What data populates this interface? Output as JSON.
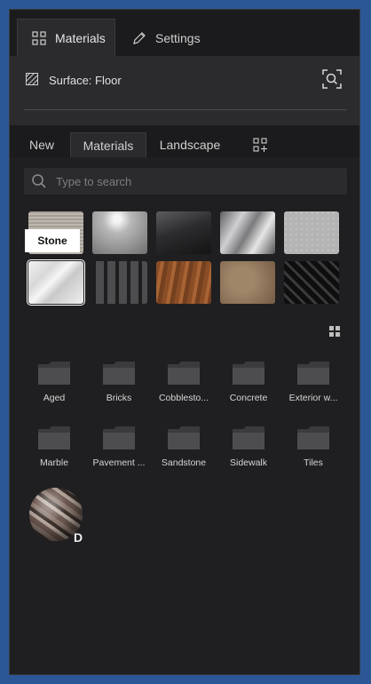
{
  "tabs": [
    {
      "label": "Materials",
      "icon": "grid-icon"
    },
    {
      "label": "Settings",
      "icon": "pencil-icon"
    }
  ],
  "surface": {
    "label": "Surface: Floor"
  },
  "sub_tabs": [
    "New",
    "Materials",
    "Landscape"
  ],
  "search": {
    "placeholder": "Type to search"
  },
  "tooltip": "Stone",
  "folders": [
    "Aged",
    "Bricks",
    "Cobblesto...",
    "Concrete",
    "Exterior w...",
    "Marble",
    "Pavement ...",
    "Sandstone",
    "Sidewalk",
    "Tiles"
  ],
  "material_badge": "D",
  "colors": {
    "background": "#2b5797",
    "panel": "#1f1f21"
  }
}
